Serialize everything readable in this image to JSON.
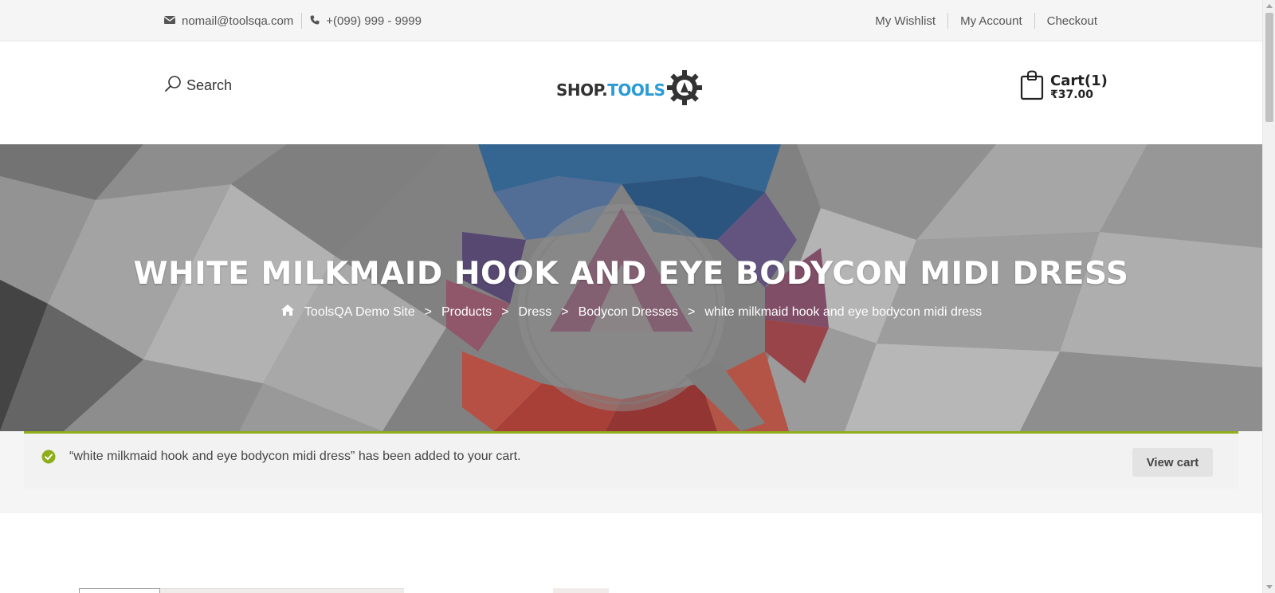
{
  "topbar": {
    "email": "nomail@toolsqa.com",
    "phone": "+(099) 999 - 9999",
    "links": [
      "My Wishlist",
      "My Account",
      "Checkout"
    ]
  },
  "header": {
    "search_label": "Search",
    "logo": {
      "part1": "SHOP.",
      "part2": "TOOLS",
      "badge": "QA"
    },
    "cart": {
      "count_label": "Cart(1)",
      "total": "₹37.00"
    }
  },
  "hero": {
    "title": "WHITE MILKMAID HOOK AND EYE BODYCON MIDI DRESS",
    "breadcrumbs": [
      "ToolsQA Demo Site",
      "Products",
      "Dress",
      "Bodycon Dresses",
      "white milkmaid hook and eye bodycon midi dress"
    ],
    "separator": ">"
  },
  "notice": {
    "message": "“white milkmaid hook and eye bodycon midi dress” has been added to your cart.",
    "button": "View cart"
  },
  "colors": {
    "accent_green": "#8fae1b",
    "brand_blue": "#2a9bd6",
    "hero_gray": "#8d8d8d"
  },
  "icons": [
    "envelope-icon",
    "phone-icon",
    "search-icon",
    "bag-icon",
    "home-icon",
    "check-circle-icon",
    "gear-logo-icon"
  ]
}
